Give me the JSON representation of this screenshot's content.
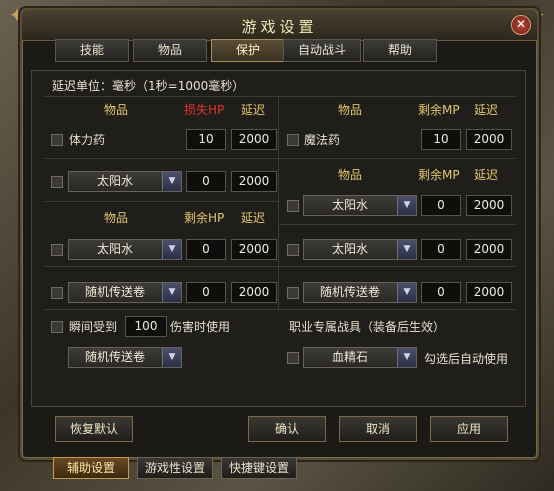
{
  "window": {
    "title": "游戏设置",
    "close_icon": "close-icon"
  },
  "tabs": [
    {
      "label": "技能"
    },
    {
      "label": "物品"
    },
    {
      "label": "保护"
    },
    {
      "label": "自动战斗"
    },
    {
      "label": "帮助"
    }
  ],
  "active_tab": "保护",
  "delay_unit": "延迟单位：毫秒（1秒=1000毫秒）",
  "left": {
    "header1": {
      "item": "物品",
      "hp": "损失HP",
      "delay": "延迟"
    },
    "row1": {
      "name": "体力药",
      "hp": "10",
      "delay": "2000"
    },
    "row2": {
      "select": "太阳水",
      "value": "0",
      "delay": "2000"
    },
    "header2": {
      "item": "物品",
      "hp": "剩余HP",
      "delay": "延迟"
    },
    "row3": {
      "select": "太阳水",
      "value": "0",
      "delay": "2000"
    },
    "row4": {
      "select": "随机传送卷",
      "value": "0",
      "delay": "2000"
    },
    "instant": {
      "prefix": "瞬间受到",
      "value": "100",
      "suffix": "伤害时使用",
      "select": "随机传送卷"
    }
  },
  "right": {
    "header1": {
      "item": "物品",
      "mp": "剩余MP",
      "delay": "延迟"
    },
    "row1": {
      "name": "魔法药",
      "mp": "10",
      "delay": "2000"
    },
    "header2": {
      "item": "物品",
      "mp": "剩余MP",
      "delay": "延迟"
    },
    "row2": {
      "select": "太阳水",
      "value": "0",
      "delay": "2000"
    },
    "row3": {
      "select": "太阳水",
      "value": "0",
      "delay": "2000"
    },
    "row4": {
      "select": "随机传送卷",
      "value": "0",
      "delay": "2000"
    },
    "class_gear": {
      "title": "职业专属战具（装备后生效）",
      "select": "血精石",
      "note": "勾选后自动使用"
    }
  },
  "buttons": {
    "reset": "恢复默认",
    "ok": "确认",
    "cancel": "取消",
    "apply": "应用"
  },
  "bottom_tabs": [
    {
      "label": "辅助设置"
    },
    {
      "label": "游戏性设置"
    },
    {
      "label": "快捷键设置"
    }
  ],
  "colors": {
    "accent": "#e3c76a",
    "warning": "#e0352b"
  }
}
